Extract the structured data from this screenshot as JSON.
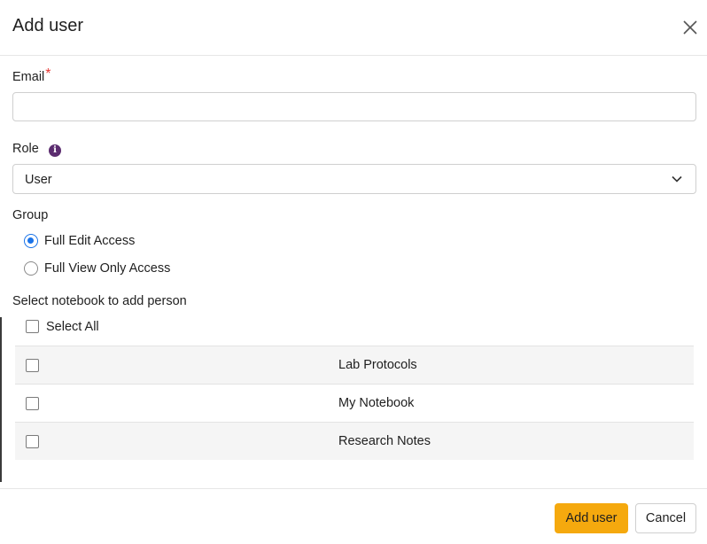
{
  "dialog": {
    "title": "Add user",
    "close_icon": "close-icon"
  },
  "email": {
    "label": "Email",
    "required_mark": "*",
    "value": "",
    "placeholder": ""
  },
  "role": {
    "label": "Role",
    "info_icon": "info-icon",
    "selected": "User",
    "chevron_icon": "chevron-down-icon"
  },
  "group": {
    "label": "Group",
    "options": [
      {
        "label": "Full Edit Access",
        "checked": true
      },
      {
        "label": "Full View Only Access",
        "checked": false
      }
    ]
  },
  "notebooks": {
    "label": "Select notebook to add person",
    "select_all_label": "Select All",
    "items": [
      {
        "name": "Lab Protocols",
        "checked": false
      },
      {
        "name": "My Notebook",
        "checked": false
      },
      {
        "name": "Research Notes",
        "checked": false
      }
    ]
  },
  "footer": {
    "add_label": "Add user",
    "cancel_label": "Cancel"
  },
  "colors": {
    "accent": "#f5a90e",
    "radio_selected": "#1a73e8",
    "required": "#e53935",
    "info": "#5b2c6f"
  }
}
